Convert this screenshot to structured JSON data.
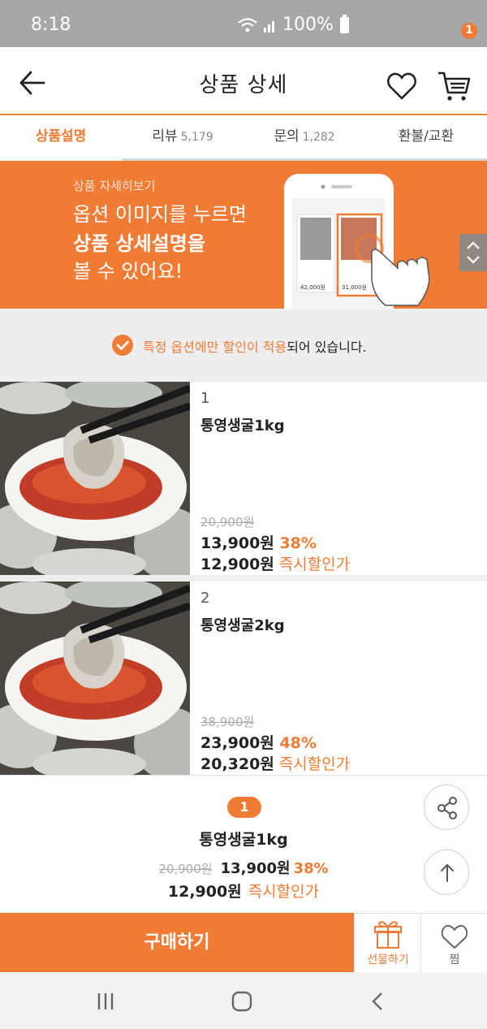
{
  "status_bar": {
    "time": "8:18",
    "battery": "100%"
  },
  "header": {
    "title": "상품 상세",
    "cart_count": "1"
  },
  "tabs": [
    {
      "label": "상품설명",
      "count": ""
    },
    {
      "label": "리뷰",
      "count": "5,179"
    },
    {
      "label": "문의",
      "count": "1,282"
    },
    {
      "label": "환불/교환",
      "count": ""
    }
  ],
  "banner": {
    "small": "상품 자세히보기",
    "line1": "옵션 이미지를 누르면",
    "line2": "상품 상세설명을",
    "line3": "볼 수 있어요!",
    "card1_price": "42,000원",
    "card2_price": "31,000원"
  },
  "notice": {
    "highlight": "특정 옵션에만 할인이 적용",
    "rest": "되어 있습니다."
  },
  "products": [
    {
      "num": "1",
      "name": "통영생굴1kg",
      "original": "20,900원",
      "price": "13,900원",
      "discount": "38%",
      "instant_price": "12,900원",
      "instant_label": "즉시할인가"
    },
    {
      "num": "2",
      "name": "통영생굴2kg",
      "original": "38,900원",
      "price": "23,900원",
      "discount": "48%",
      "instant_price": "20,320원",
      "instant_label": "즉시할인가"
    }
  ],
  "selected": {
    "num": "1",
    "name": "통영생굴1kg",
    "original": "20,900원",
    "price": "13,900원",
    "discount": "38%",
    "instant_price": "12,900원",
    "instant_label": "즉시할인가"
  },
  "bottom_bar": {
    "buy": "구매하기",
    "gift": "선물하기",
    "wish": "찜"
  },
  "colors": {
    "accent": "#f07b35",
    "status_bar": "#a7a7a7"
  },
  "icons": [
    "back-arrow-icon",
    "heart-icon",
    "cart-icon",
    "check-icon",
    "share-icon",
    "arrow-up-icon",
    "gift-icon",
    "recent-apps-icon",
    "home-icon",
    "back-nav-icon"
  ]
}
